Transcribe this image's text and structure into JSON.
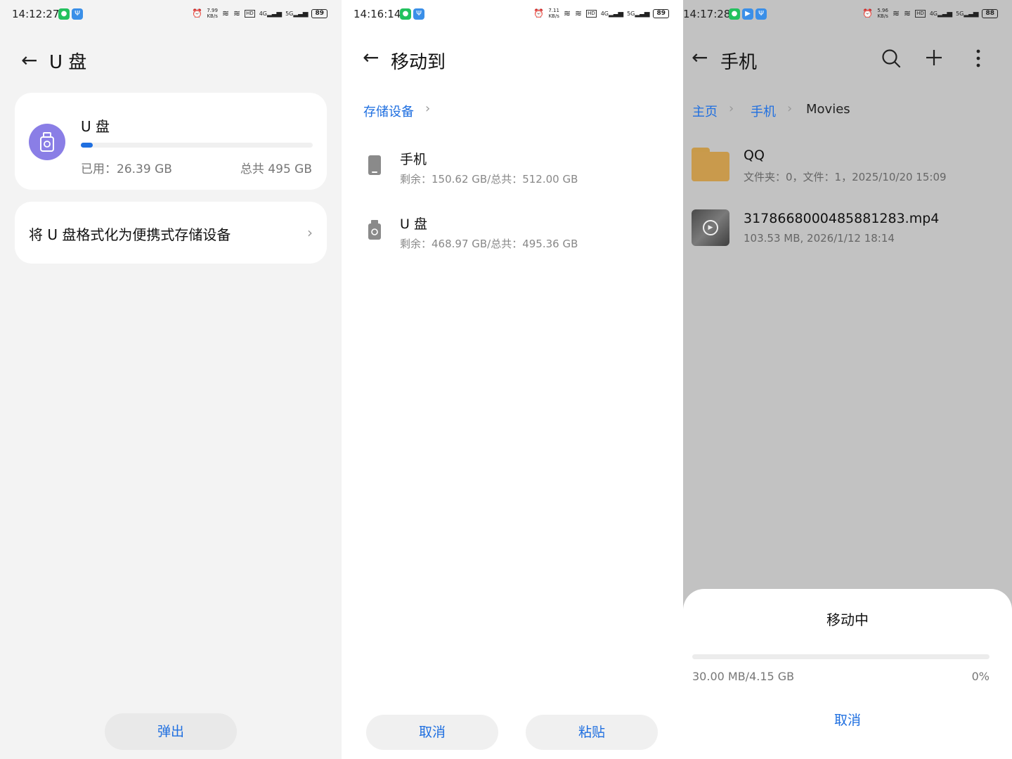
{
  "panel1": {
    "status": {
      "time": "14:12:27",
      "speed": "7.99",
      "speed_unit": "KB/s",
      "battery": "89"
    },
    "title": "U 盘",
    "card": {
      "name": "U 盘",
      "used": "已用：26.39 GB",
      "total": "总共 495 GB",
      "usage_fraction": 0.053
    },
    "format_row": "将 U 盘格式化为便携式存储设备",
    "eject_button": "弹出"
  },
  "panel2": {
    "status": {
      "time": "14:16:14",
      "speed": "7.11",
      "speed_unit": "KB/s",
      "battery": "89"
    },
    "title": "移动到",
    "breadcrumb": "存储设备",
    "devices": [
      {
        "name": "手机",
        "detail": "剩余：150.62 GB/总共：512.00 GB"
      },
      {
        "name": "U 盘",
        "detail": "剩余：468.97 GB/总共：495.36 GB"
      }
    ],
    "cancel_button": "取消",
    "paste_button": "粘贴"
  },
  "panel3": {
    "status": {
      "time": "14:17:28",
      "speed": "5.96",
      "speed_unit": "KB/s",
      "battery": "88"
    },
    "title": "手机",
    "breadcrumb": [
      "主页",
      "手机",
      "Movies"
    ],
    "files": [
      {
        "name": "QQ",
        "detail": "文件夹：0，文件：1，2025/10/20 15:09"
      },
      {
        "name": "3178668000485881283.mp4",
        "detail": "103.53 MB, 2026/1/12 18:14"
      }
    ],
    "sheet": {
      "title": "移动中",
      "progress_text": "30.00 MB/4.15 GB",
      "percent": "0%",
      "progress_fraction": 0.0,
      "cancel": "取消"
    }
  },
  "colors": {
    "accent": "#1f6fe0",
    "usb_circle": "#8a7ee6",
    "folder": "#c99a4c"
  }
}
